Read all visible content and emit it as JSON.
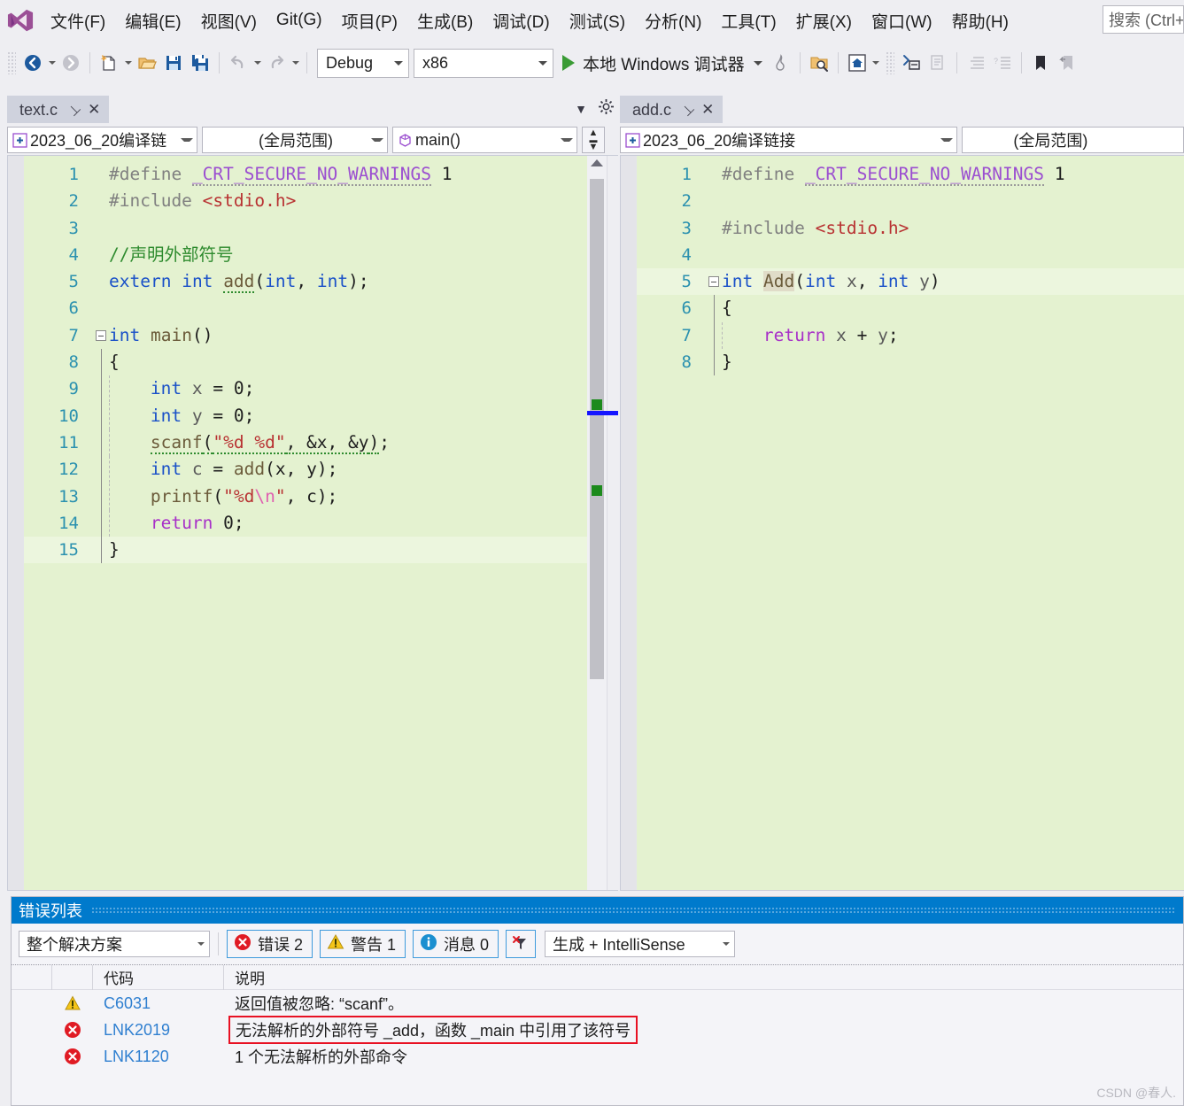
{
  "app": {
    "title": "Microsoft Visual Studio",
    "logo_icon": "visual-studio-logo"
  },
  "menu": {
    "items": [
      {
        "label": "文件(F)",
        "name": "file"
      },
      {
        "label": "编辑(E)",
        "name": "edit"
      },
      {
        "label": "视图(V)",
        "name": "view"
      },
      {
        "label": "Git(G)",
        "name": "git"
      },
      {
        "label": "项目(P)",
        "name": "project"
      },
      {
        "label": "生成(B)",
        "name": "build"
      },
      {
        "label": "调试(D)",
        "name": "debug"
      },
      {
        "label": "测试(S)",
        "name": "test"
      },
      {
        "label": "分析(N)",
        "name": "analyze"
      },
      {
        "label": "工具(T)",
        "name": "tools"
      },
      {
        "label": "扩展(X)",
        "name": "extensions"
      },
      {
        "label": "窗口(W)",
        "name": "window"
      },
      {
        "label": "帮助(H)",
        "name": "help"
      }
    ],
    "search_placeholder": "搜索 (Ctrl+"
  },
  "toolbar": {
    "icons": [
      {
        "name": "navigate-backward-icon"
      },
      {
        "name": "navigate-forward-icon"
      },
      {
        "name": "new-file-icon"
      },
      {
        "name": "open-file-icon"
      },
      {
        "name": "save-icon"
      },
      {
        "name": "save-all-icon"
      },
      {
        "name": "undo-icon"
      },
      {
        "name": "redo-icon"
      }
    ],
    "configuration": "Debug",
    "platform": "x86",
    "run_label": "本地 Windows 调试器",
    "right_icons": [
      {
        "name": "hot-reload-icon"
      },
      {
        "name": "solution-explorer-search-icon"
      },
      {
        "name": "home-icon"
      },
      {
        "name": "quick-launch-icon"
      },
      {
        "name": "comment-icon"
      },
      {
        "name": "uncomment-icon"
      },
      {
        "name": "increase-indent-icon"
      },
      {
        "name": "decrease-indent-icon"
      },
      {
        "name": "bookmark-icon"
      },
      {
        "name": "previous-bookmark-icon"
      }
    ]
  },
  "left_pane": {
    "tab": {
      "name": "text.c",
      "pin_icon": "pin-icon",
      "close_icon": "close-icon"
    },
    "project": "2023_06_20编译链",
    "scope": "(全局范围)",
    "member": "main()",
    "project_icon": "project-icon",
    "member_icon": "method-icon",
    "split_icon": "split-editor-icon",
    "tab_overflow_icon": "chevron-down-icon",
    "tab_settings_icon": "gear-icon",
    "code_lines": [
      {
        "n": "1",
        "html": "<span class='gl'>#define</span> <span class='mac dots-underline'>_CRT_SECURE_NO_WARNINGS</span> <span class='pl'>1</span>",
        "indent": 0,
        "fold": "minus-hidden"
      },
      {
        "n": "2",
        "html": "<span class='gl'>#include</span> <span class='str'>&lt;stdio.h&gt;</span>",
        "indent": 0
      },
      {
        "n": "3",
        "html": "",
        "indent": 0
      },
      {
        "n": "4",
        "html": "<span class='cmt'>//声明外部符号</span>",
        "indent": 0
      },
      {
        "n": "5",
        "html": "<span class='kw'>extern</span> <span class='kw'>int</span> <span class='fn sq'>add</span><span class='pl'>(</span><span class='kw'>int</span><span class='pl'>, </span><span class='kw'>int</span><span class='pl'>);</span>",
        "indent": 0
      },
      {
        "n": "6",
        "html": "",
        "indent": 0
      },
      {
        "n": "7",
        "html": "<span class='kw'>int</span> <span class='fn'>main</span><span class='pl'>()</span>",
        "indent": 0,
        "fold": "minus"
      },
      {
        "n": "8",
        "html": "<span class='pl'>{</span>",
        "indent": 0,
        "fold": "line"
      },
      {
        "n": "9",
        "html": "    <span class='kw'>int</span> <span class='var'>x</span> <span class='pl'>= 0;</span>",
        "indent": 1,
        "fold": "dash"
      },
      {
        "n": "10",
        "html": "    <span class='kw'>int</span> <span class='var'>y</span> <span class='pl'>= 0;</span>",
        "indent": 1,
        "fold": "dash"
      },
      {
        "n": "11",
        "html": "    <span class='fn sq'>scanf</span><span class='pl sq'>(</span><span class='str sq'>\"%d %d\"</span><span class='pl sq'>, &amp;x, &amp;y</span><span class='pl sq'>)</span><span class='pl'>;</span>",
        "indent": 1,
        "fold": "dash"
      },
      {
        "n": "12",
        "html": "    <span class='kw'>int</span> <span class='var'>c</span> <span class='pl'>= </span><span class='fn'>add</span><span class='pl'>(x, y);</span>",
        "indent": 1,
        "fold": "dash"
      },
      {
        "n": "13",
        "html": "    <span class='fn'>printf</span><span class='pl'>(</span><span class='str'>\"%d</span><span class='esc'>\\n</span><span class='str'>\"</span><span class='pl'>, c);</span>",
        "indent": 1,
        "fold": "dash"
      },
      {
        "n": "14",
        "html": "    <span class='kw2'>return</span> <span class='pl'>0;</span>",
        "indent": 1,
        "fold": "dash"
      },
      {
        "n": "15",
        "html": "<span class='pl'>}</span>",
        "indent": 0,
        "fold": "line",
        "current": true
      }
    ],
    "scrollbar": {
      "markers": [
        "saved-change-marker",
        "saved-change-marker"
      ],
      "caret_marker": "caret-position-marker"
    }
  },
  "right_pane": {
    "tab": {
      "name": "add.c",
      "pin_icon": "pin-icon",
      "close_icon": "close-icon"
    },
    "project": "2023_06_20编译链接",
    "scope": "(全局范围)",
    "project_icon": "project-icon",
    "code_lines": [
      {
        "n": "1",
        "html": "<span class='gl'>#define</span> <span class='mac dots-underline'>_CRT_SECURE_NO_WARNINGS</span> <span class='pl'>1</span>",
        "indent": 0
      },
      {
        "n": "2",
        "html": "",
        "indent": 0
      },
      {
        "n": "3",
        "html": "<span class='gl'>#include</span> <span class='str'>&lt;stdio.h&gt;</span>",
        "indent": 0
      },
      {
        "n": "4",
        "html": "",
        "indent": 0
      },
      {
        "n": "5",
        "html": "<span class='kw'>int</span> <span class='fn hl'>Add</span><span class='pl'>(</span><span class='kw'>int</span> <span class='var'>x</span><span class='pl'>, </span><span class='kw'>int</span> <span class='var'>y</span><span class='pl'>)</span>",
        "indent": 0,
        "fold": "minus",
        "current": true
      },
      {
        "n": "6",
        "html": "<span class='pl'>{</span>",
        "indent": 0,
        "fold": "line"
      },
      {
        "n": "7",
        "html": "    <span class='kw2'>return</span> <span class='var'>x</span> <span class='pl'>+</span> <span class='var'>y</span><span class='pl'>;</span>",
        "indent": 1,
        "fold": "dash"
      },
      {
        "n": "8",
        "html": "<span class='pl'>}</span>",
        "indent": 0,
        "fold": "line"
      }
    ]
  },
  "error_list": {
    "title": "错误列表",
    "scope": "整个解决方案",
    "chips": [
      {
        "label": "错误 2",
        "icon": "error-icon",
        "name": "errors-filter"
      },
      {
        "label": "警告 1",
        "icon": "warning-icon",
        "name": "warnings-filter"
      },
      {
        "label": "消息 0",
        "icon": "info-icon",
        "name": "messages-filter"
      }
    ],
    "clear_filter_icon": "clear-filter-icon",
    "build_filter": "生成 + IntelliSense",
    "columns": {
      "code": "代码",
      "description": "说明"
    },
    "rows": [
      {
        "severity": "warning",
        "icon": "warning-icon",
        "code": "C6031",
        "description": "返回值被忽略: “scanf”。",
        "boxed": false
      },
      {
        "severity": "error",
        "icon": "error-icon",
        "code": "LNK2019",
        "description": "无法解析的外部符号 _add，函数 _main 中引用了该符号",
        "boxed": true
      },
      {
        "severity": "error",
        "icon": "error-icon",
        "code": "LNK1120",
        "description": "1 个无法解析的外部命令",
        "boxed": false
      }
    ],
    "highlight_color": "#e81123"
  },
  "watermark": "CSDN @春人."
}
